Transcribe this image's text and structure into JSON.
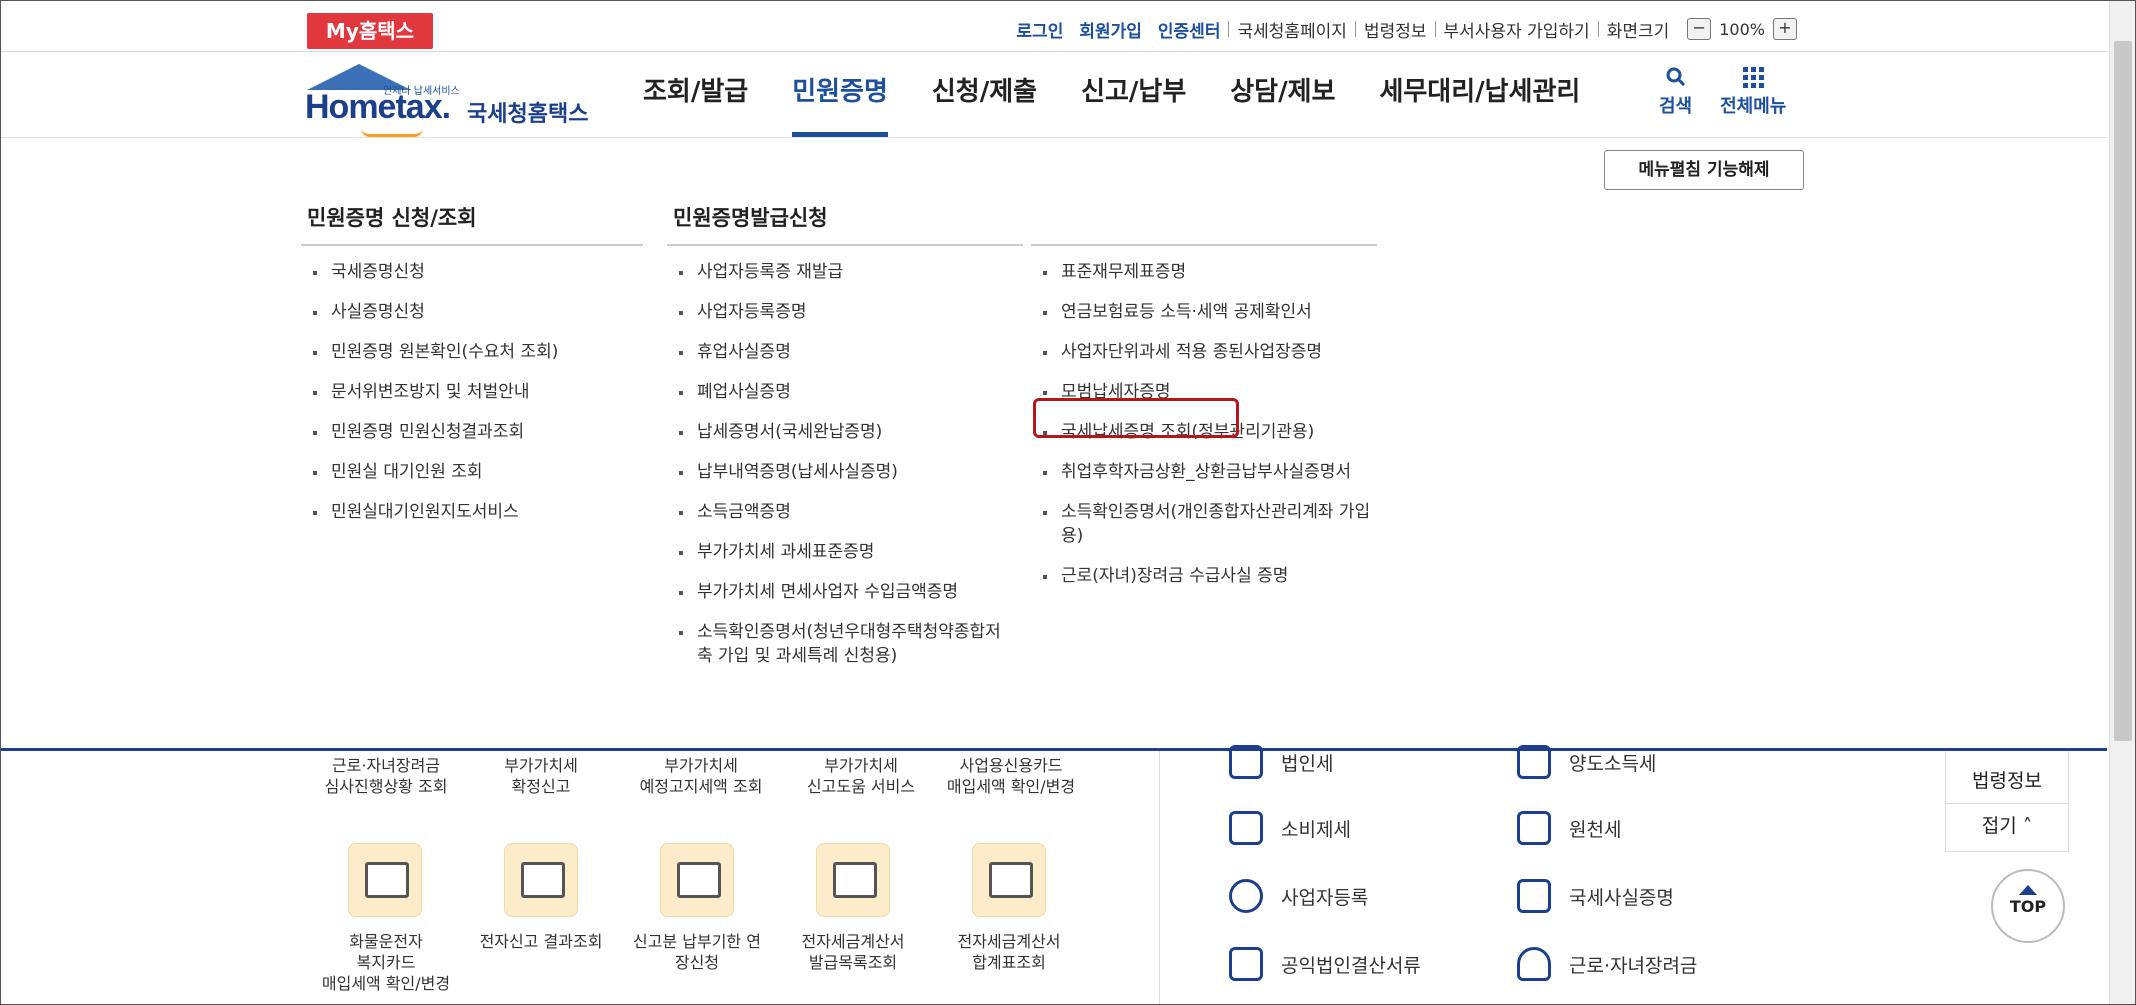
{
  "topbar": {
    "my_button": "My홈택스",
    "links": [
      "로그인",
      "회원가입",
      "인증센터",
      "국세청홈페이지",
      "법령정보",
      "부서사용자 가입하기",
      "화면크기"
    ],
    "zoom_minus": "−",
    "zoom_value": "100%",
    "zoom_plus": "+"
  },
  "header": {
    "logo_tagline": "언제나 납세서비스",
    "logo_word": "Hometax.",
    "logo_name": "국세청홈택스",
    "nav": [
      "조회/발급",
      "민원증명",
      "신청/제출",
      "신고/납부",
      "상담/제보",
      "세무대리/납세관리"
    ],
    "active_nav": "민원증명",
    "search_label": "검색",
    "allmenu_label": "전체메뉴"
  },
  "mega": {
    "unfold_button": "메뉴펼침 기능해제",
    "col1": {
      "title": "민원증명 신청/조회",
      "items": [
        "국세증명신청",
        "사실증명신청",
        "민원증명 원본확인(수요처 조회)",
        "문서위변조방지 및 처벌안내",
        "민원증명 민원신청결과조회",
        "민원실 대기인원 조회",
        "민원실대기인원지도서비스"
      ]
    },
    "col2": {
      "title": "민원증명발급신청",
      "items": [
        "사업자등록증 재발급",
        "사업자등록증명",
        "휴업사실증명",
        "폐업사실증명",
        "납세증명서(국세완납증명)",
        "납부내역증명(납세사실증명)",
        "소득금액증명",
        "부가가치세 과세표준증명",
        "부가가치세 면세사업자 수입금액증명",
        "소득확인증명서(청년우대형주택청약종합저축 가입 및 과세특례 신청용)"
      ]
    },
    "col3": {
      "items": [
        "표준재무제표증명",
        "연금보험료등 소득·세액 공제확인서",
        "사업자단위과세 적용 종된사업장증명",
        "모범납세자증명",
        "국세납세증명 조회(정부관리기관용)",
        "취업후학자금상환_상환금납부사실증명서",
        "소득확인증명서(개인종합자산관리계좌 가입용)",
        "근로(자녀)장려금 수급사실 증명"
      ]
    }
  },
  "lower": {
    "top_labels": [
      "근로·자녀장려금\n심사진행상황 조회",
      "부가가치세\n확정신고",
      "부가가치세\n예정고지세액 조회",
      "부가가치세\n신고도움 서비스",
      "사업용신용카드\n매입세액 확인/변경"
    ],
    "tiles": [
      "화물운전자\n복지카드\n매입세액 확인/변경",
      "전자신고 결과조회",
      "신고분 납부기한 연\n장신청",
      "전자세금계산서\n발급목록조회",
      "전자세금계산서\n합계표조회"
    ],
    "tax_items": [
      "법인세",
      "양도소득세",
      "소비제세",
      "원천세",
      "사업자등록",
      "국세사실증명",
      "공익법인결산서류",
      "근로·자녀장려금"
    ],
    "side_law": "법령정보",
    "side_fold": "접기 ˄",
    "top_button": "TOP"
  }
}
